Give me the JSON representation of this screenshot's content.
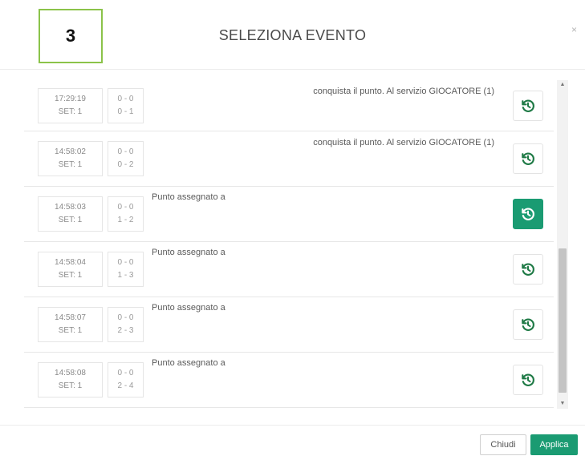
{
  "modal": {
    "step_number": "3",
    "title": "SELEZIONA EVENTO",
    "close_symbol": "×"
  },
  "events": [
    {
      "time": "17:29:19",
      "set": "SET: 1",
      "score_top": "0 - 0",
      "score_bottom": "0 - 1",
      "description": "conquista il punto. Al servizio GIOCATORE (1)",
      "align": "right",
      "selected": false
    },
    {
      "time": "14:58:02",
      "set": "SET: 1",
      "score_top": "0 - 0",
      "score_bottom": "0 - 2",
      "description": "conquista il punto. Al servizio GIOCATORE (1)",
      "align": "right",
      "selected": false
    },
    {
      "time": "14:58:03",
      "set": "SET: 1",
      "score_top": "0 - 0",
      "score_bottom": "1 - 2",
      "description": "Punto assegnato a",
      "align": "left",
      "selected": true
    },
    {
      "time": "14:58:04",
      "set": "SET: 1",
      "score_top": "0 - 0",
      "score_bottom": "1 - 3",
      "description": "Punto assegnato a",
      "align": "left",
      "selected": false
    },
    {
      "time": "14:58:07",
      "set": "SET: 1",
      "score_top": "0 - 0",
      "score_bottom": "2 - 3",
      "description": "Punto assegnato a",
      "align": "left",
      "selected": false
    },
    {
      "time": "14:58:08",
      "set": "SET: 1",
      "score_top": "0 - 0",
      "score_bottom": "2 - 4",
      "description": "Punto assegnato a",
      "align": "left",
      "selected": false
    }
  ],
  "icons": {
    "restore": "restore-history-icon",
    "scroll_up": "scroll-up-arrow-icon",
    "scroll_down": "scroll-down-arrow-icon"
  },
  "colors": {
    "accent": "#1a9b72",
    "badge_border": "#8bc34a",
    "icon_green": "#1f7a46"
  },
  "footer": {
    "close_label": "Chiudi",
    "apply_label": "Applica"
  }
}
